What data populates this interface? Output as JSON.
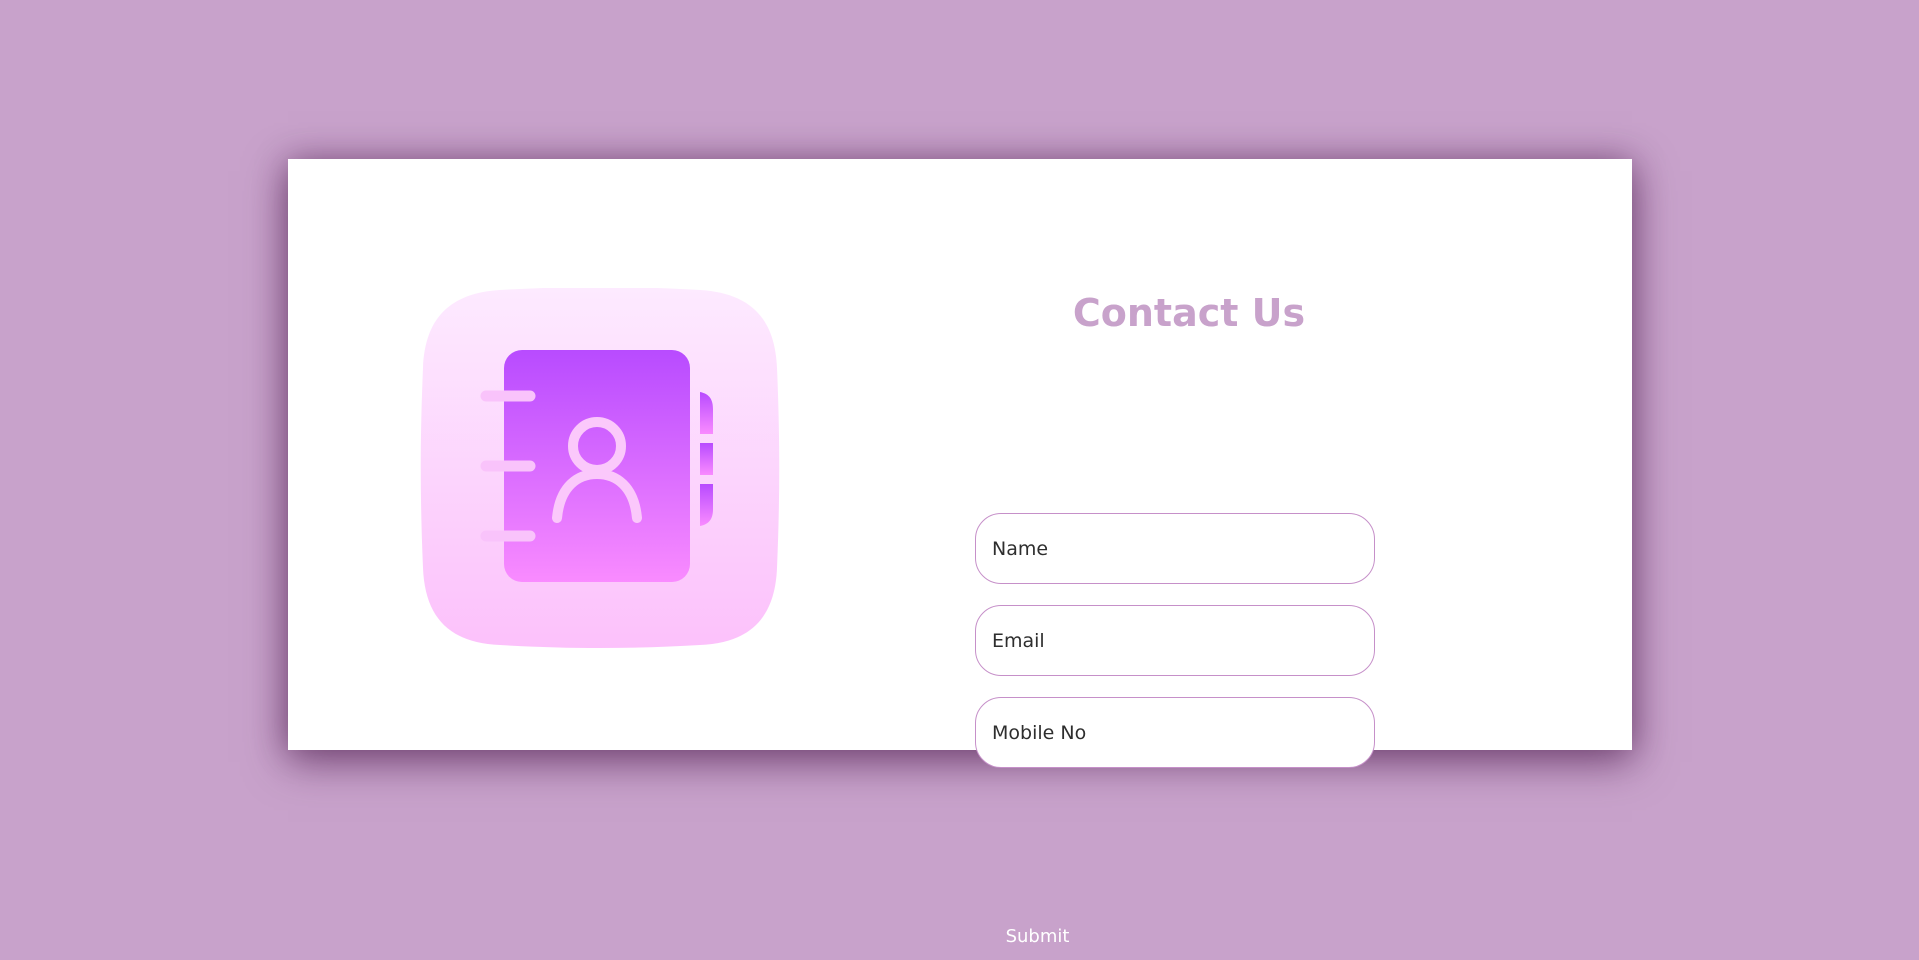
{
  "contact": {
    "title": "Contact Us",
    "fields": {
      "name": {
        "placeholder": "Name"
      },
      "email": {
        "placeholder": "Email"
      },
      "mobile": {
        "placeholder": "Mobile No"
      }
    },
    "submit_label": "Submit"
  },
  "illustration": {
    "icon": "contact-book-icon"
  },
  "colors": {
    "background": "#c8a2cb",
    "card": "#ffffff",
    "accent": "#c8a2cb",
    "field_border": "#c690c9",
    "icon_bg_top": "#fde6ff",
    "icon_bg_bottom": "#fcc3fb",
    "book_top": "#b74cff",
    "book_bottom": "#f98aff"
  }
}
